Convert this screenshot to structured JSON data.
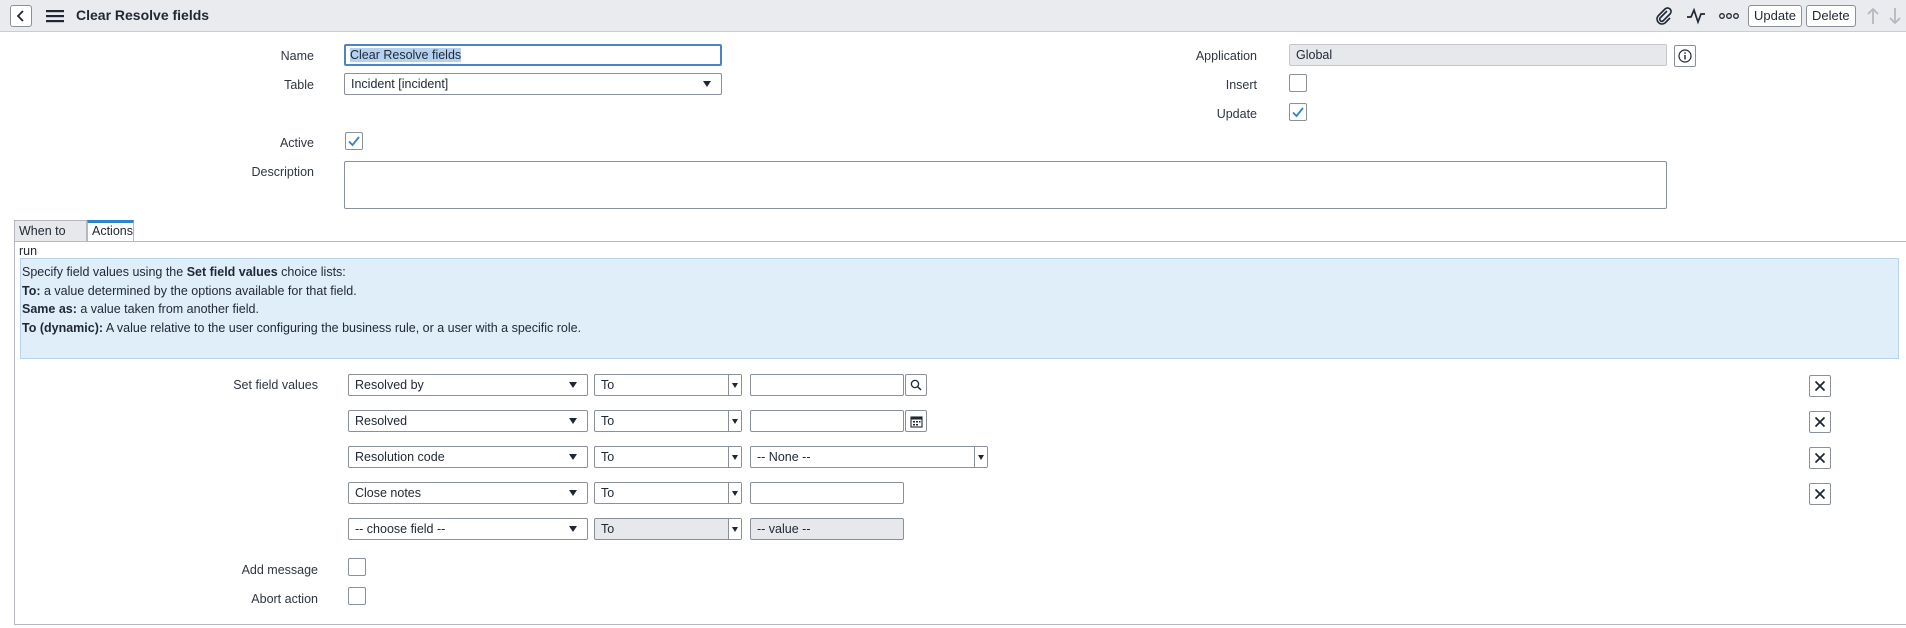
{
  "header": {
    "title": "Clear Resolve fields",
    "update_label": "Update",
    "delete_label": "Delete"
  },
  "form": {
    "name_label": "Name",
    "name_value": "Clear Resolve fields",
    "table_label": "Table",
    "table_value": "Incident [incident]",
    "application_label": "Application",
    "application_value": "Global",
    "insert_label": "Insert",
    "insert_checked": false,
    "update_label": "Update",
    "update_checked": true,
    "active_label": "Active",
    "active_checked": true,
    "description_label": "Description"
  },
  "tabs": [
    {
      "label": "When to run",
      "active": false
    },
    {
      "label": "Actions",
      "active": true
    }
  ],
  "info": {
    "line1_pre": "Specify field values using the ",
    "line1_bold": "Set field values",
    "line1_post": " choice lists:",
    "line2_bold": "To:",
    "line2_text": " a value determined by the options available for that field.",
    "line3_bold": "Same as:",
    "line3_text": " a value taken from another field.",
    "line4_bold": "To (dynamic):",
    "line4_text": " A value relative to the user configuring the business rule, or a user with a specific role."
  },
  "actions": {
    "set_field_values_label": "Set field values",
    "rows": [
      {
        "field": "Resolved by",
        "op": "To",
        "value": ""
      },
      {
        "field": "Resolved",
        "op": "To",
        "value": ""
      },
      {
        "field": "Resolution code",
        "op": "To",
        "value": "-- None --"
      },
      {
        "field": "Close notes",
        "op": "To",
        "value": ""
      },
      {
        "field": "-- choose field --",
        "op": "To",
        "value": "-- value --"
      }
    ],
    "add_message_label": "Add message",
    "abort_action_label": "Abort action"
  },
  "colors": {
    "accent": "#2f83d0",
    "info_bg": "#e0eef9",
    "header_bg": "#e9ebee"
  }
}
